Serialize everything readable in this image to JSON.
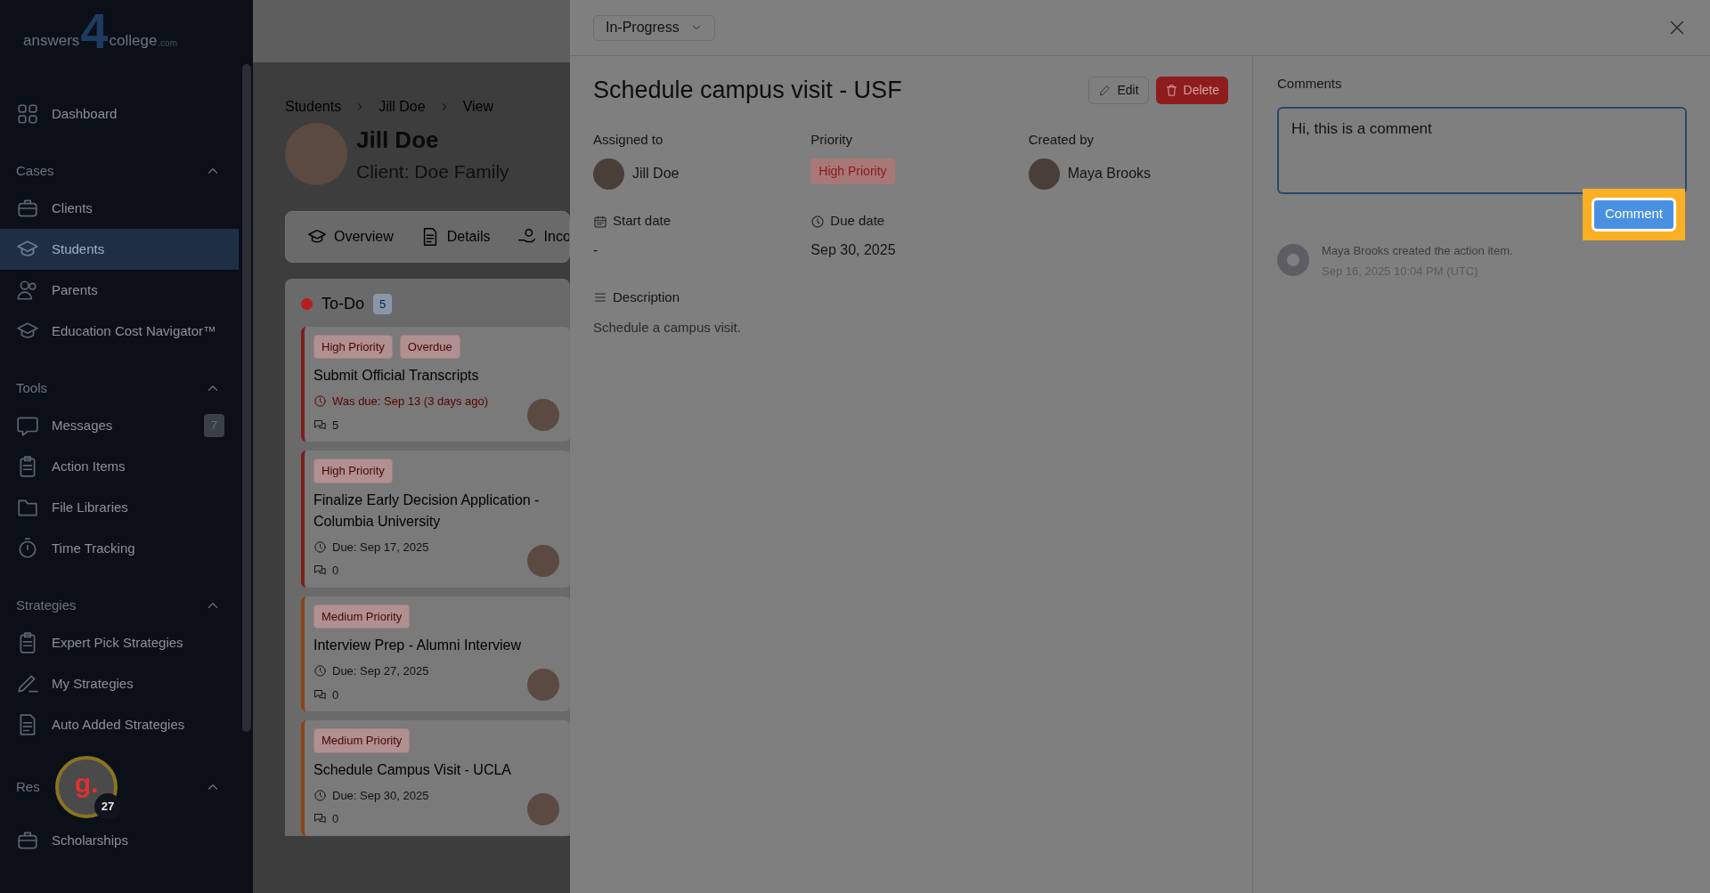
{
  "logo": {
    "parts": [
      "answers",
      "4",
      "college",
      ".com"
    ]
  },
  "sidebar": {
    "top": [
      {
        "label": "Dashboard",
        "selected": false
      }
    ],
    "sections": [
      {
        "title": "Cases",
        "expanded": true,
        "items": [
          {
            "label": "Clients",
            "selected": false
          },
          {
            "label": "Students",
            "selected": true
          },
          {
            "label": "Parents",
            "selected": false
          },
          {
            "label": "Education Cost Navigator™",
            "selected": false
          }
        ]
      },
      {
        "title": "Tools",
        "expanded": true,
        "items": [
          {
            "label": "Messages",
            "selected": false,
            "badge": "7"
          },
          {
            "label": "Action Items",
            "selected": false
          },
          {
            "label": "File Libraries",
            "selected": false
          },
          {
            "label": "Time Tracking",
            "selected": false
          }
        ]
      },
      {
        "title": "Strategies",
        "expanded": true,
        "items": [
          {
            "label": "Expert Pick Strategies",
            "selected": false
          },
          {
            "label": "My Strategies",
            "selected": false
          },
          {
            "label": "Auto Added Strategies",
            "selected": false
          }
        ]
      },
      {
        "title": "Res",
        "expanded": true,
        "items": [
          {
            "label": "Scholarships",
            "selected": false
          }
        ]
      }
    ]
  },
  "helper_bubble": {
    "letter": "g.",
    "count": "27"
  },
  "breadcrumbs": [
    "Students",
    "Jill Doe",
    "View"
  ],
  "student": {
    "name": "Jill Doe",
    "client": "Client: Doe Family"
  },
  "tabs": [
    {
      "label": "Overview"
    },
    {
      "label": "Details"
    },
    {
      "label": "Inco"
    }
  ],
  "column": {
    "title": "To-Do",
    "color": "#b91c1c",
    "count": "5",
    "cards": [
      {
        "color": "#7f1d1d",
        "tags": [
          {
            "label": "High Priority"
          },
          {
            "label": "Overdue"
          }
        ],
        "title": "Submit Official Transcripts",
        "due": "Was due: Sep 13 (3 days ago)",
        "overdue": true,
        "comments": "5"
      },
      {
        "color": "#7f1d1d",
        "tags": [
          {
            "label": "High Priority"
          }
        ],
        "title": "Finalize Early Decision Application - Columbia University",
        "due": "Due: Sep 17, 2025",
        "overdue": false,
        "comments": "0"
      },
      {
        "color": "#8a4515",
        "tags": [
          {
            "label": "Medium Priority"
          }
        ],
        "title": "Interview Prep - Alumni Interview",
        "due": "Due: Sep 27, 2025",
        "overdue": false,
        "comments": "0"
      },
      {
        "color": "#8a4515",
        "tags": [
          {
            "label": "Medium Priority"
          }
        ],
        "title": "Schedule Campus Visit - UCLA",
        "due": "Due: Sep 30, 2025",
        "overdue": false,
        "comments": "0"
      }
    ]
  },
  "drawer": {
    "status": "In-Progress",
    "title": "Schedule campus visit - USF",
    "edit": "Edit",
    "delete": "Delete",
    "fields": [
      {
        "label": "Assigned to",
        "kind": "person",
        "value": "Jill Doe"
      },
      {
        "label": "Priority",
        "kind": "tag",
        "value": "High Priority"
      },
      {
        "label": "Created by",
        "kind": "person",
        "value": "Maya Brooks"
      },
      {
        "label": "Start date",
        "kind": "date",
        "value": "-"
      },
      {
        "label": "Due date",
        "kind": "date",
        "value": "Sep 30, 2025"
      }
    ],
    "description_label": "Description",
    "description": "Schedule a campus visit.",
    "comments": {
      "title": "Comments",
      "value": "Hi, this is a comment",
      "button": "Comment",
      "highlighted": true,
      "activity": [
        {
          "text": "Maya Brooks created the action item.",
          "time": "Sep 16, 2025 10:04 PM (UTC)"
        }
      ]
    }
  }
}
